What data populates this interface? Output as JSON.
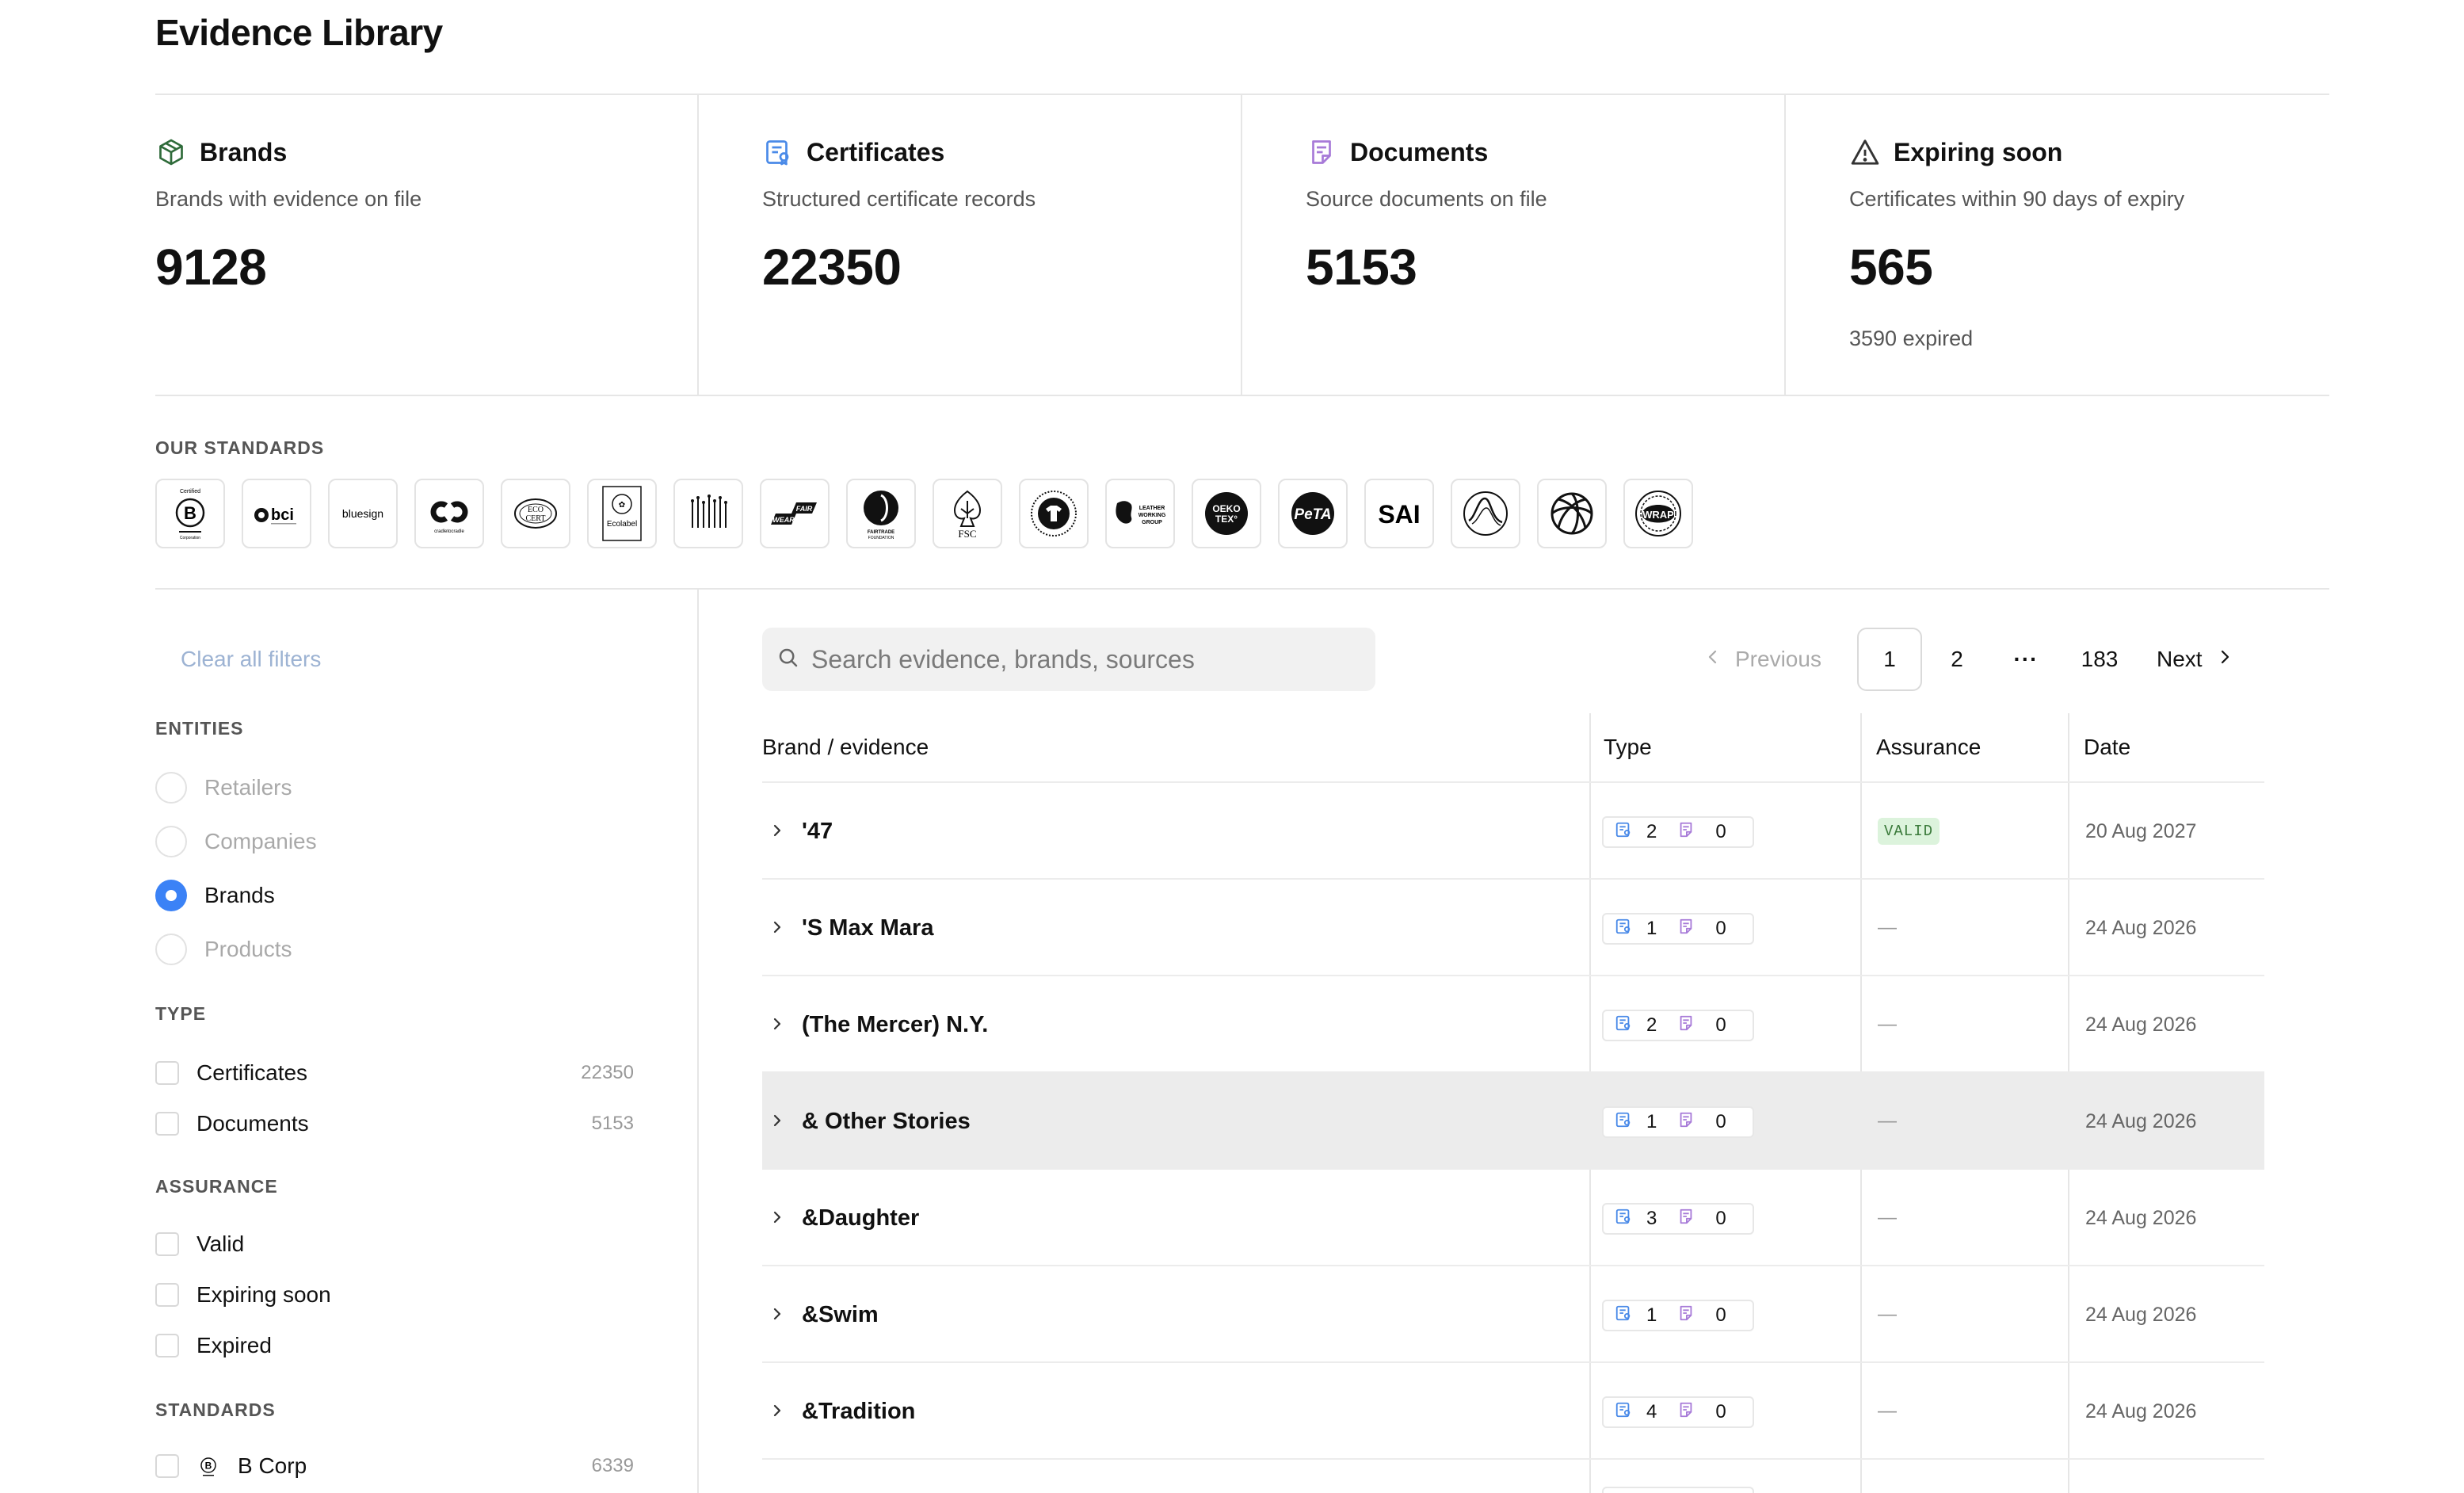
{
  "page": {
    "title": "Evidence Library"
  },
  "stats": [
    {
      "icon": "box-icon",
      "title": "Brands",
      "desc": "Brands with evidence on file",
      "value": "9128",
      "extra": ""
    },
    {
      "icon": "certificate-icon",
      "title": "Certificates",
      "desc": "Structured certificate records",
      "value": "22350",
      "extra": ""
    },
    {
      "icon": "document-icon",
      "title": "Documents",
      "desc": "Source documents on file",
      "value": "5153",
      "extra": ""
    },
    {
      "icon": "warning-icon",
      "title": "Expiring soon",
      "desc": "Certificates within 90 days of expiry",
      "value": "565",
      "extra": "3590 expired"
    }
  ],
  "standards": {
    "label": "OUR STANDARDS",
    "logos": [
      {
        "name": "b-corp-logo",
        "text": "B"
      },
      {
        "name": "bci-logo",
        "text": "bci"
      },
      {
        "name": "bluesign-logo",
        "text": "bluesign"
      },
      {
        "name": "cradle-to-cradle-logo",
        "text": ""
      },
      {
        "name": "ecocert-logo",
        "text": "ECO CERT"
      },
      {
        "name": "eu-ecolabel-logo",
        "text": "Ecolabel"
      },
      {
        "name": "standard-logo-7",
        "text": ""
      },
      {
        "name": "fair-wear-logo",
        "text": "FAIR WEAR"
      },
      {
        "name": "fairtrade-logo",
        "text": "FAIRTRADE"
      },
      {
        "name": "fsc-logo",
        "text": "FSC"
      },
      {
        "name": "gots-logo",
        "text": ""
      },
      {
        "name": "leather-working-group-logo",
        "text": "LEATHER WORKING GROUP"
      },
      {
        "name": "oeko-tex-logo",
        "text": "OEKO TEX"
      },
      {
        "name": "peta-logo",
        "text": "PeTA"
      },
      {
        "name": "sai-logo",
        "text": "SAI"
      },
      {
        "name": "standard-logo-16",
        "text": ""
      },
      {
        "name": "standard-logo-17",
        "text": ""
      },
      {
        "name": "wrap-logo",
        "text": "WRAP"
      }
    ]
  },
  "sidebar": {
    "clear_filters": "Clear all filters",
    "entities": {
      "label": "ENTITIES",
      "options": [
        {
          "label": "Retailers",
          "checked": false
        },
        {
          "label": "Companies",
          "checked": false
        },
        {
          "label": "Brands",
          "checked": true
        },
        {
          "label": "Products",
          "checked": false
        }
      ]
    },
    "type": {
      "label": "TYPE",
      "options": [
        {
          "label": "Certificates",
          "count": "22350"
        },
        {
          "label": "Documents",
          "count": "5153"
        }
      ]
    },
    "assurance": {
      "label": "ASSURANCE",
      "options": [
        {
          "label": "Valid"
        },
        {
          "label": "Expiring soon"
        },
        {
          "label": "Expired"
        }
      ]
    },
    "standards": {
      "label": "STANDARDS",
      "options": [
        {
          "label": "B Corp",
          "count": "6339",
          "icon": "b-corp-icon"
        }
      ]
    }
  },
  "search": {
    "placeholder": "Search evidence, brands, sources",
    "value": ""
  },
  "pagination": {
    "previous": "Previous",
    "pages": [
      "1",
      "2",
      "183"
    ],
    "ellipsis": "···",
    "next": "Next",
    "current": "1"
  },
  "table": {
    "columns": [
      "Brand / evidence",
      "Type",
      "Assurance",
      "Date"
    ],
    "rows": [
      {
        "brand": "'47",
        "certs": "2",
        "docs": "0",
        "assurance": "VALID",
        "date": "20 Aug 2027"
      },
      {
        "brand": "'S Max Mara",
        "certs": "1",
        "docs": "0",
        "assurance": "—",
        "date": "24 Aug 2026"
      },
      {
        "brand": "(The Mercer) N.Y.",
        "certs": "2",
        "docs": "0",
        "assurance": "—",
        "date": "24 Aug 2026"
      },
      {
        "brand": "& Other Stories",
        "certs": "1",
        "docs": "0",
        "assurance": "—",
        "date": "24 Aug 2026"
      },
      {
        "brand": "&Daughter",
        "certs": "3",
        "docs": "0",
        "assurance": "—",
        "date": "24 Aug 2026"
      },
      {
        "brand": "&Swim",
        "certs": "1",
        "docs": "0",
        "assurance": "—",
        "date": "24 Aug 2026"
      },
      {
        "brand": "&Tradition",
        "certs": "4",
        "docs": "0",
        "assurance": "—",
        "date": "24 Aug 2026"
      }
    ]
  },
  "colors": {
    "accent": "#3b82f6",
    "valid_bg": "#dcf3dc",
    "valid_text": "#3a7a3a",
    "brand_icon": "#2f6b3a",
    "cert_icon": "#4a8ae8",
    "doc_icon": "#a77ad8"
  }
}
